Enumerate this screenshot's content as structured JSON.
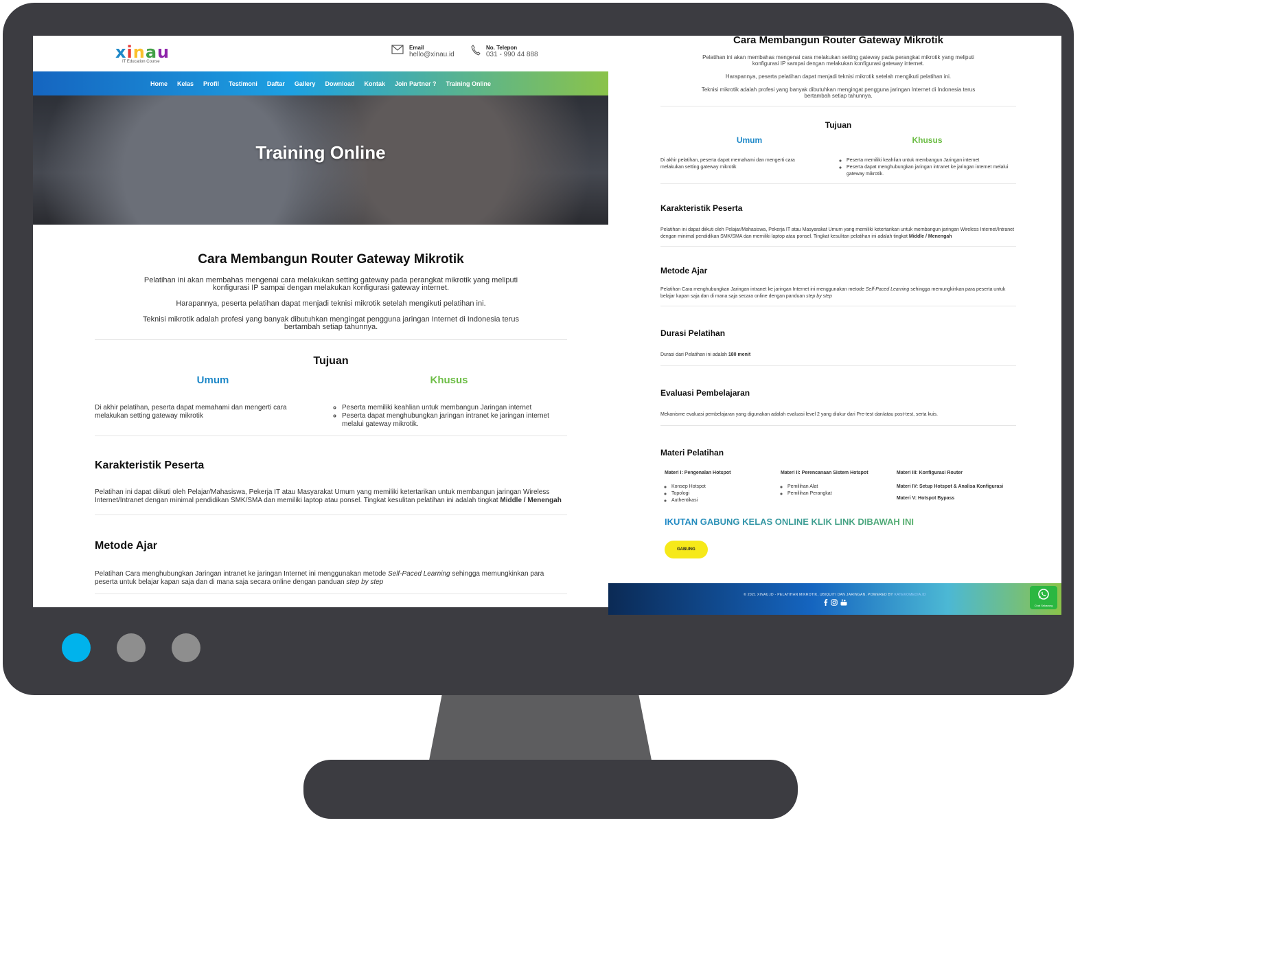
{
  "brand": {
    "logo_text": "xinau",
    "logo_tagline": "IT Education Course",
    "logo_colors": [
      "#1e88c8",
      "#e53935",
      "#fbc02d",
      "#43a047",
      "#8e24aa"
    ]
  },
  "contact": {
    "email_label": "Email",
    "email_value": "hello@xinau.id",
    "phone_label": "No. Telepon",
    "phone_value": "031 - 990 44 888"
  },
  "nav": [
    "Home",
    "Kelas",
    "Profil",
    "Testimoni",
    "Daftar",
    "Gallery",
    "Download",
    "Kontak",
    "Join Partner ?",
    "Training Online"
  ],
  "hero": {
    "title": "Training Online"
  },
  "course": {
    "title": "Cara Membangun Router Gateway Mikrotik",
    "intro": [
      "Pelatihan ini akan membahas mengenai cara melakukan setting gateway pada perangkat mikrotik yang meliputi konfigurasi IP sampai dengan melakukan konfigurasi gateway internet.",
      "Harapannya, peserta pelatihan dapat menjadi teknisi mikrotik setelah mengikuti pelatihan ini.",
      "Teknisi mikrotik adalah profesi yang banyak dibutuhkan mengingat pengguna jaringan Internet di Indonesia terus bertambah setiap tahunnya."
    ],
    "tujuan": {
      "heading": "Tujuan",
      "umum_label": "Umum",
      "umum_text": "Di akhir pelatihan, peserta dapat memahami dan mengerti cara melakukan setting gateway mikrotik",
      "khusus_label": "Khusus",
      "khusus_items": [
        "Peserta memiliki keahlian untuk membangun Jaringan internet",
        "Peserta dapat menghubungkan jaringan intranet ke jaringan internet melalui gateway mikrotik."
      ]
    },
    "karakteristik": {
      "heading": "Karakteristik Peserta",
      "text": "Pelatihan ini dapat diikuti oleh Pelajar/Mahasiswa, Pekerja IT atau Masyarakat Umum yang memiliki ketertarikan untuk membangun jaringan Wireless Internet/Intranet dengan minimal pendidikan SMK/SMA dan memiliki laptop atau ponsel. Tingkat kesulitan pelatihan ini adalah tingkat",
      "level": "Middle / Menengah"
    },
    "metode": {
      "heading": "Metode Ajar",
      "text_a": "Pelatihan Cara menghubungkan Jaringan intranet ke jaringan Internet ini menggunakan metode",
      "em_a": "Self-Paced Learning",
      "text_b": "sehingga memungkinkan para peserta untuk belajar kapan saja dan di mana saja secara online dengan panduan",
      "em_b": "step by step"
    },
    "durasi": {
      "heading": "Durasi Pelatihan",
      "text": "Durasi dari Pelatihan ini adalah",
      "value": "180 menit"
    },
    "evaluasi": {
      "heading": "Evaluasi Pembelajaran",
      "text": "Mekanisme evaluasi pembelajaran yang digunakan adalah evaluasi level 2 yang diukur dari Pre-test dan/atau post-test, serta kuis."
    },
    "materi": {
      "heading": "Materi Pelatihan",
      "m1_title": "Materi I: Pengenalan Hotspot",
      "m1_items": [
        "Konsep Hotspot",
        "Topologi",
        "Authentikasi"
      ],
      "m2_title": "Materi II: Perencanaan Sistem Hotspot",
      "m2_items": [
        "Pemilihan Alat",
        "Pemilihan Perangkat"
      ],
      "m3_title": "Materi III: Konfigurasi Router",
      "m4_title": "Materi IV: Setup Hotspot & Analisa Konfigurasi",
      "m5_title": "Materi V: Hotspot Bypass"
    },
    "cta": {
      "text": "IKUTAN GABUNG KELAS ONLINE KLIK LINK DIBAWAH INI",
      "button": "GABUNG"
    }
  },
  "footer": {
    "copyright": "© 2021 XINAU.ID - PELATIHAN MIKROTIK, UBIQUITI DAN JARINGAN. POWERED BY",
    "powered": "KATEKOMEDIA.ID",
    "social_icons": [
      "facebook-icon",
      "instagram-icon",
      "youtube-icon"
    ],
    "whatsapp_label": "Chat Sekarang"
  },
  "colors": {
    "accent_blue": "#1e88c8",
    "accent_green": "#6cbd45",
    "button_yellow": "#f6e91a",
    "monitor_frame": "#3c3c41"
  }
}
